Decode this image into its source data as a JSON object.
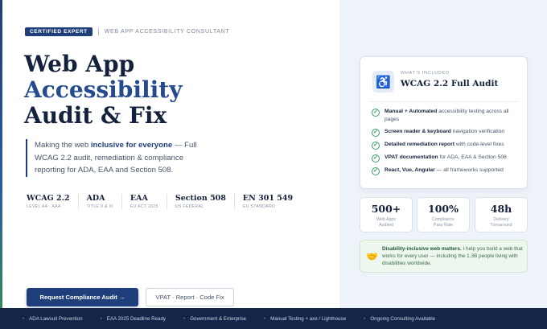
{
  "hero": {
    "badge": "CERTIFIED EXPERT",
    "badge_sub": "WEB APP ACCESSIBILITY CONSULTANT",
    "title_line1": "Web App",
    "title_line2": "Accessibility",
    "title_line3": "Audit & Fix",
    "lead_pre": "Making the web ",
    "lead_bold": "inclusive for everyone",
    "lead_post": " — Full WCAG 2.2 audit, remediation & compliance reporting for ADA, EAA and Section 508."
  },
  "standards": [
    {
      "name": "WCAG 2.2",
      "sub": "LEVEL AA · AAA"
    },
    {
      "name": "ADA",
      "sub": "TITLE II & III"
    },
    {
      "name": "EAA",
      "sub": "EU ACT 2025"
    },
    {
      "name": "Section 508",
      "sub": "US FEDERAL"
    },
    {
      "name": "EN 301 549",
      "sub": "EU STANDARD"
    }
  ],
  "buttons": {
    "primary": "Request Compliance Audit →",
    "secondary": "VPAT · Report · Code Fix"
  },
  "card": {
    "icon": "accessibility-icon",
    "eyebrow": "WHAT'S INCLUDED",
    "title": "WCAG 2.2 Full Audit",
    "features": [
      {
        "bold": "Manual + Automated",
        "text": " accessibility testing across all pages"
      },
      {
        "bold": "Screen reader & keyboard",
        "text": " navigation verification"
      },
      {
        "bold": "Detailed remediation report",
        "text": " with code-level fixes"
      },
      {
        "bold": "VPAT documentation",
        "text": " for ADA, EAA & Section 508"
      },
      {
        "bold": "React, Vue, Angular",
        "text": " — all frameworks supported"
      }
    ]
  },
  "stats": [
    {
      "value": "500+",
      "label1": "Web Apps",
      "label2": "Audited"
    },
    {
      "value": "100%",
      "label1": "Compliance",
      "label2": "Pass Rate"
    },
    {
      "value": "48h",
      "label1": "Delivery",
      "label2": "Turnaround"
    }
  ],
  "note": {
    "icon": "handshake-icon",
    "bold": "Disability-inclusive web matters.",
    "text": " I help you build a web that works for every user — including the 1.3B people living with disabilities worldwide."
  },
  "ticker": [
    "ADA Lawsuit Prevention",
    "EAA 2025 Deadline Ready",
    "Government & Enterprise",
    "Manual Testing + axe / Lighthouse",
    "Ongoing Consulting Available"
  ],
  "colors": {
    "brand_navy": "#1f3f7a",
    "accent_blue": "#234b8d",
    "success_green": "#3f9a68",
    "ticker_bg": "#14254a"
  }
}
